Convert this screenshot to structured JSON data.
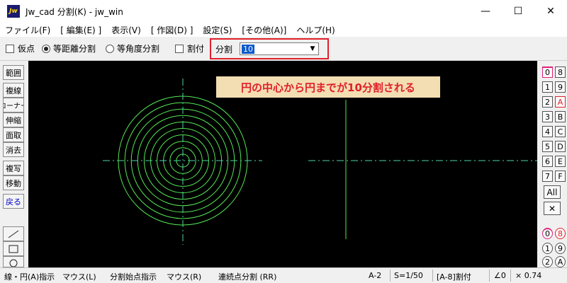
{
  "window": {
    "app_icon": "Jw",
    "title": "Jw_cad 分割(K) - jw_win",
    "minimize": "—",
    "maximize": "☐",
    "close": "✕"
  },
  "menu": [
    "ファイル(F)",
    "[ 編集(E) ]",
    "表示(V)",
    "[ 作図(D) ]",
    "設定(S)",
    "[その他(A)]",
    "ヘルプ(H)"
  ],
  "toolbar": {
    "kari_ten": "仮点",
    "equal_dist": "等距離分割",
    "equal_angle": "等角度分割",
    "waritsuke": "割付",
    "bunkatsu_label": "分割",
    "bunkatsu_value": "10",
    "combo_arrow": "▼"
  },
  "left_tools": [
    "範囲",
    "複線",
    "コーナー",
    "伸縮",
    "面取",
    "消去",
    "複写",
    "移動",
    "戻る"
  ],
  "left_shapes": [
    "line-icon",
    "rectangle-icon",
    "circle-icon"
  ],
  "annotation": "円の中心から円までが10分割される",
  "layers": {
    "col_a": [
      "0",
      "1",
      "2",
      "3",
      "4",
      "5",
      "6",
      "7"
    ],
    "col_b": [
      "8",
      "9",
      "A",
      "B",
      "C",
      "D",
      "E",
      "F"
    ],
    "all": "All",
    "x_mark": "✕",
    "groups_a": [
      "0",
      "1",
      "2"
    ],
    "groups_b": [
      "8",
      "9",
      "A"
    ]
  },
  "status": {
    "left_hint": "線・円(A)指示",
    "mouse_l": "マウス(L)",
    "split_point": "分割始点指示",
    "mouse_r": "マウス(R)",
    "continuous": "連続点分割 (RR)",
    "layer": "A-2",
    "scale": "S=1/50",
    "group": "[A-8]割付",
    "angle": "∠0",
    "zoom": "× 0.74"
  },
  "colors": {
    "canvas": "#000000",
    "circle": "#55e855",
    "axis": "#4ad4a4",
    "highlight_border": "#e0202a",
    "annotation_bg": "#f3ddb3",
    "annotation_text": "#e0202a"
  }
}
